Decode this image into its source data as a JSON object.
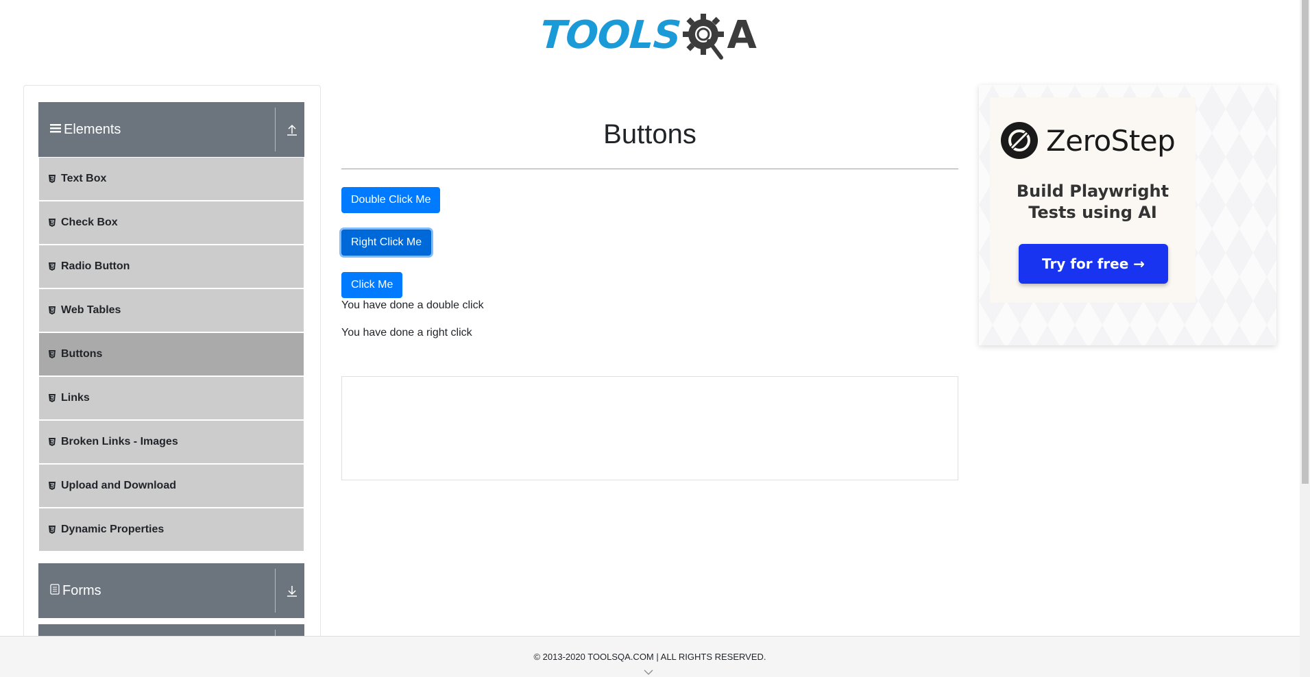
{
  "header": {
    "logo_text_tools": "TOOLS",
    "logo_text_a": "A",
    "logo_alt": "TOOLSQA"
  },
  "sidebar": {
    "groups": [
      {
        "title": "Elements",
        "icon": "hamburger-icon",
        "toggle_icon": "collapse-up-icon",
        "expanded": true,
        "items": [
          {
            "label": "Text Box",
            "active": false
          },
          {
            "label": "Check Box",
            "active": false
          },
          {
            "label": "Radio Button",
            "active": false
          },
          {
            "label": "Web Tables",
            "active": false
          },
          {
            "label": "Buttons",
            "active": true
          },
          {
            "label": "Links",
            "active": false
          },
          {
            "label": "Broken Links - Images",
            "active": false
          },
          {
            "label": "Upload and Download",
            "active": false
          },
          {
            "label": "Dynamic Properties",
            "active": false
          }
        ]
      },
      {
        "title": "Forms",
        "icon": "document-icon",
        "toggle_icon": "expand-down-icon",
        "expanded": false
      }
    ]
  },
  "main": {
    "title": "Buttons",
    "buttons": {
      "double_click": "Double Click Me",
      "right_click": "Right Click Me",
      "click": "Click Me"
    },
    "messages": {
      "double_click": "You have done a double click",
      "right_click": "You have done a right click"
    }
  },
  "ad": {
    "brand": "ZeroStep",
    "tagline_line1": "Build Playwright",
    "tagline_line2": "Tests using AI",
    "cta": "Try for free →"
  },
  "footer": {
    "text": "© 2013-2020 TOOLSQA.COM | ALL RIGHTS RESERVED."
  },
  "colors": {
    "primary_button": "#007bff",
    "sidebar_header": "#6c757d",
    "menu_item": "#cccccc",
    "menu_item_active": "#aaaaaa",
    "logo_blue": "#1b9ad8",
    "ad_cta": "#1834f0"
  }
}
